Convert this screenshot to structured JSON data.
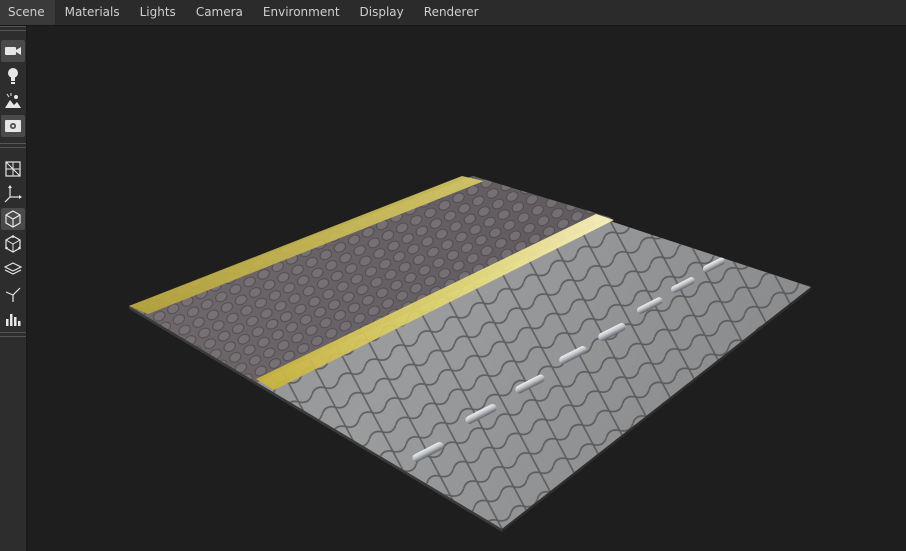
{
  "menubar": {
    "items": [
      "Scene",
      "Materials",
      "Lights",
      "Camera",
      "Environment",
      "Display",
      "Renderer"
    ]
  },
  "toolbar": {
    "group1": [
      "camera-icon",
      "light-bulb-icon",
      "environment-image-icon",
      "render-settings-icon"
    ],
    "group2": [
      "wireframe-icon",
      "axis-gizmo-icon",
      "solid-cube-icon",
      "bounding-box-icon",
      "ground-plane-icon",
      "light-direction-icon",
      "histogram-icon"
    ],
    "active": [
      "camera-icon",
      "solid-cube-icon"
    ]
  },
  "colors": {
    "menubar_bg": "#2b2b2b",
    "toolbar_bg": "#2d2d2d",
    "viewport_bg": "#1e1e1e",
    "menu_text": "#cfcfcf",
    "icon": "#d8d8d8",
    "road_marking_yellow": "#d8c64a",
    "paving_grey": "#8c8e90",
    "paving_dark": "#6a6568",
    "road_stud": "#c8ccd0"
  }
}
